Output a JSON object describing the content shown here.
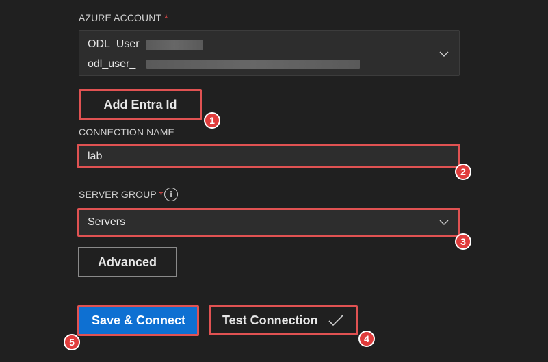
{
  "azure_account": {
    "label": "AZURE ACCOUNT",
    "required_mark": "*",
    "display_name": "ODL_User",
    "email": "odl_user_"
  },
  "add_entra_id": {
    "label": "Add Entra Id"
  },
  "connection_name": {
    "label": "CONNECTION NAME",
    "value": "lab"
  },
  "server_group": {
    "label": "SERVER GROUP",
    "required_mark": "*",
    "info_icon": "i",
    "selected": "Servers"
  },
  "advanced": {
    "label": "Advanced"
  },
  "footer": {
    "save_connect": "Save & Connect",
    "test_connection": "Test Connection",
    "test_status_icon": "checkmark-icon"
  },
  "callouts": [
    "1",
    "2",
    "3",
    "4",
    "5"
  ],
  "colors": {
    "background": "#202020",
    "field": "#2d2d2d",
    "primary": "#0e70d2",
    "highlight": "#e05252",
    "required": "#f14c4c"
  }
}
